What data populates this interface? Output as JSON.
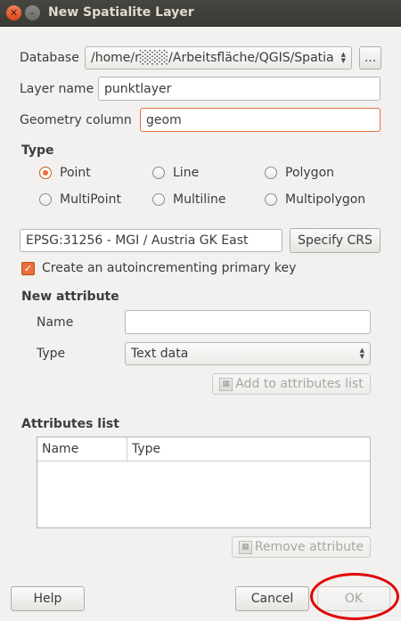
{
  "window": {
    "title": "New Spatialite Layer"
  },
  "form": {
    "database_label": "Database",
    "database_value": "/home/r░░░/Arbeitsfläche/QGIS/Spatia",
    "browse_label": "...",
    "layer_name_label": "Layer name",
    "layer_name_value": "punktlayer",
    "geometry_column_label": "Geometry column",
    "geometry_column_value": "geom"
  },
  "type_section": {
    "title": "Type",
    "options": [
      "Point",
      "Line",
      "Polygon",
      "MultiPoint",
      "Multiline",
      "Multipolygon"
    ],
    "selected": "Point"
  },
  "crs": {
    "value": "EPSG:31256 - MGI / Austria GK East",
    "button_label": "Specify CRS"
  },
  "primary_key": {
    "label": "Create an autoincrementing primary key",
    "checked": true
  },
  "new_attribute": {
    "title": "New attribute",
    "name_label": "Name",
    "name_value": "",
    "type_label": "Type",
    "type_value": "Text data",
    "add_button": "Add to attributes list"
  },
  "attributes_list": {
    "title": "Attributes list",
    "columns": [
      "Name",
      "Type"
    ],
    "rows": [],
    "remove_button": "Remove attribute"
  },
  "buttons": {
    "help": "Help",
    "cancel": "Cancel",
    "ok": "OK"
  },
  "colors": {
    "accent": "#e8703a",
    "annotation": "#e00000",
    "titlebar": "#3c3b37"
  }
}
